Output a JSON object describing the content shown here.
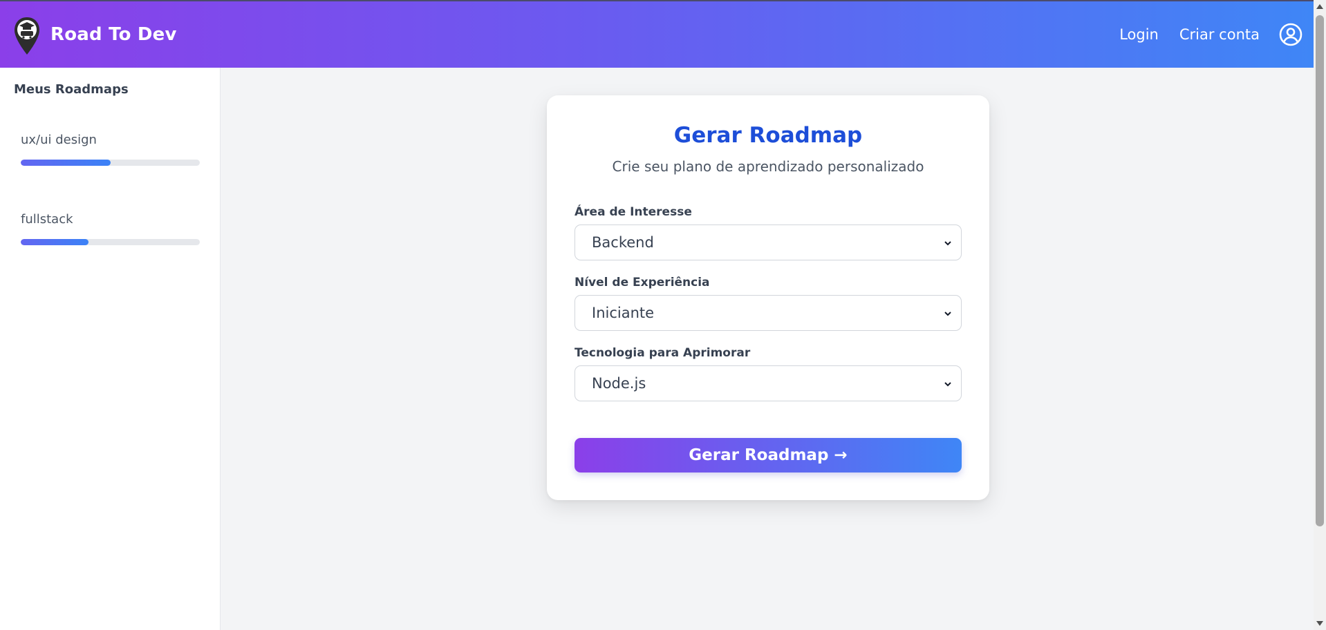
{
  "header": {
    "brand": "Road To Dev",
    "nav": {
      "login": "Login",
      "signup": "Criar conta"
    },
    "gradient": [
      "#8b3fe9",
      "#3f86f6"
    ]
  },
  "sidebar": {
    "title": "Meus Roadmaps",
    "items": [
      {
        "label": "ux/ui design",
        "progress_percent": 50
      },
      {
        "label": "fullstack",
        "progress_percent": 38
      }
    ]
  },
  "form": {
    "title": "Gerar Roadmap",
    "subtitle": "Crie seu plano de aprendizado personalizado",
    "fields": [
      {
        "label": "Área de Interesse",
        "value": "Backend"
      },
      {
        "label": "Nível de Experiência",
        "value": "Iniciante"
      },
      {
        "label": "Tecnologia para Aprimorar",
        "value": "Node.js"
      }
    ],
    "submit_label": "Gerar Roadmap →",
    "title_color": "#1d4ed8"
  },
  "icons": {
    "logo": "map-pin-graduation-icon",
    "user": "user-circle-icon",
    "select_arrow": "chevron-down-icon"
  }
}
